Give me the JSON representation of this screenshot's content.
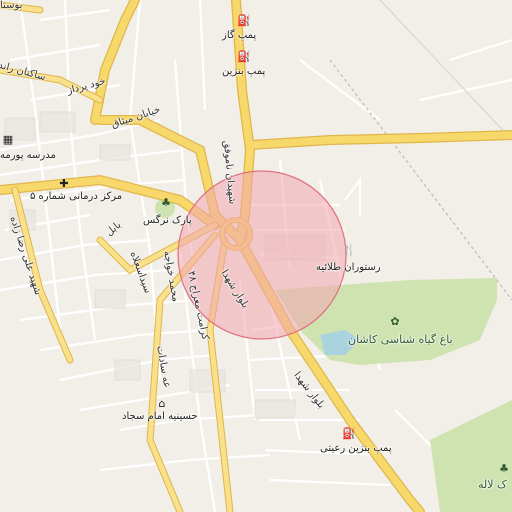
{
  "map": {
    "labels": {
      "gas_station_gas": "پمپ گاز",
      "gas_station_1": "پمپ بنزین",
      "gas_station_2": "پمپ بنزین رعیتی",
      "restaurant": "رستوران طلائیه",
      "garden": "باغ گیاه شناسی کاشان",
      "park_narges": "پارک نرگس",
      "clinic": "مرکز درمانی شماره ۵",
      "school": "مدرسه پورمه",
      "husseiniya": "حسینیه امام سجاد",
      "boulevard_1": "بلوار شهدا",
      "boulevard_2": "بلوار شهدا",
      "street_khod_pardaz": "خود پرداز",
      "street_mirdamad": "خیابان میثاق",
      "street_rahnamai": "شهید علی رضا زاده",
      "street_marsdaran": "سیداسعلاه",
      "street_taleghani": "شهیدان ناموفق",
      "street_mahmood": "محمد خواجه",
      "street_gomaran": "کرامت معراج ۴۸",
      "street_alley": "بابل",
      "street_fazel": "عه سادات",
      "top_label": "بوستا",
      "park_lale": "ک لاله",
      "top_street": "ساکنان راند"
    },
    "colors": {
      "background": "#f2efe9",
      "major_road": "#f7d96b",
      "major_road_edge": "#e0b54a",
      "minor_road": "#ffffff",
      "park": "#cfe3b1",
      "water": "#aad3df",
      "highlight_fill": "#f2a6b0",
      "highlight_stroke": "#e07080"
    }
  }
}
